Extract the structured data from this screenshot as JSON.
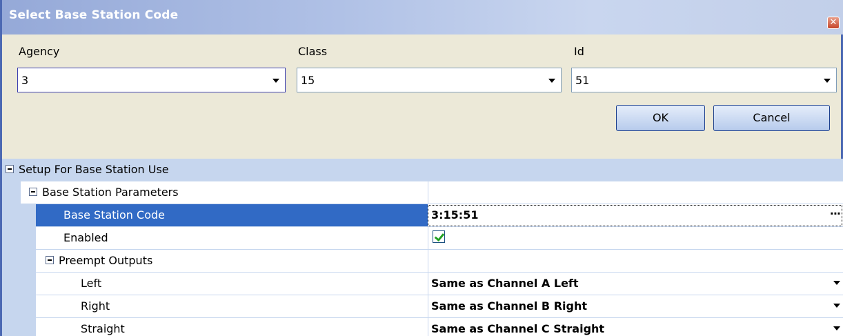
{
  "dialog": {
    "title": "Select Base Station  Code",
    "close_icon": "close-icon",
    "agency": {
      "label": "Agency",
      "value": "3"
    },
    "class": {
      "label": "Class",
      "value": "15"
    },
    "id": {
      "label": "Id",
      "value": "51"
    },
    "ok_label": "OK",
    "cancel_label": "Cancel"
  },
  "grid": {
    "category": "Setup For Base Station Use",
    "base_params": "Base Station Parameters",
    "code_label": "Base Station Code",
    "code_value": "3:15:51",
    "enabled_label": "Enabled",
    "enabled_value": true,
    "preempt": "Preempt Outputs",
    "left_label": "Left",
    "left_value": "Same as Channel A Left",
    "right_label": "Right",
    "right_value": "Same as Channel B Right",
    "straight_label": "Straight",
    "straight_value": "Same as Channel C Straight",
    "ellipsis": "···"
  },
  "colors": {
    "selection": "#316AC5",
    "category_bg": "#C6D6EE",
    "dialog_bg": "#ECE9D8"
  }
}
